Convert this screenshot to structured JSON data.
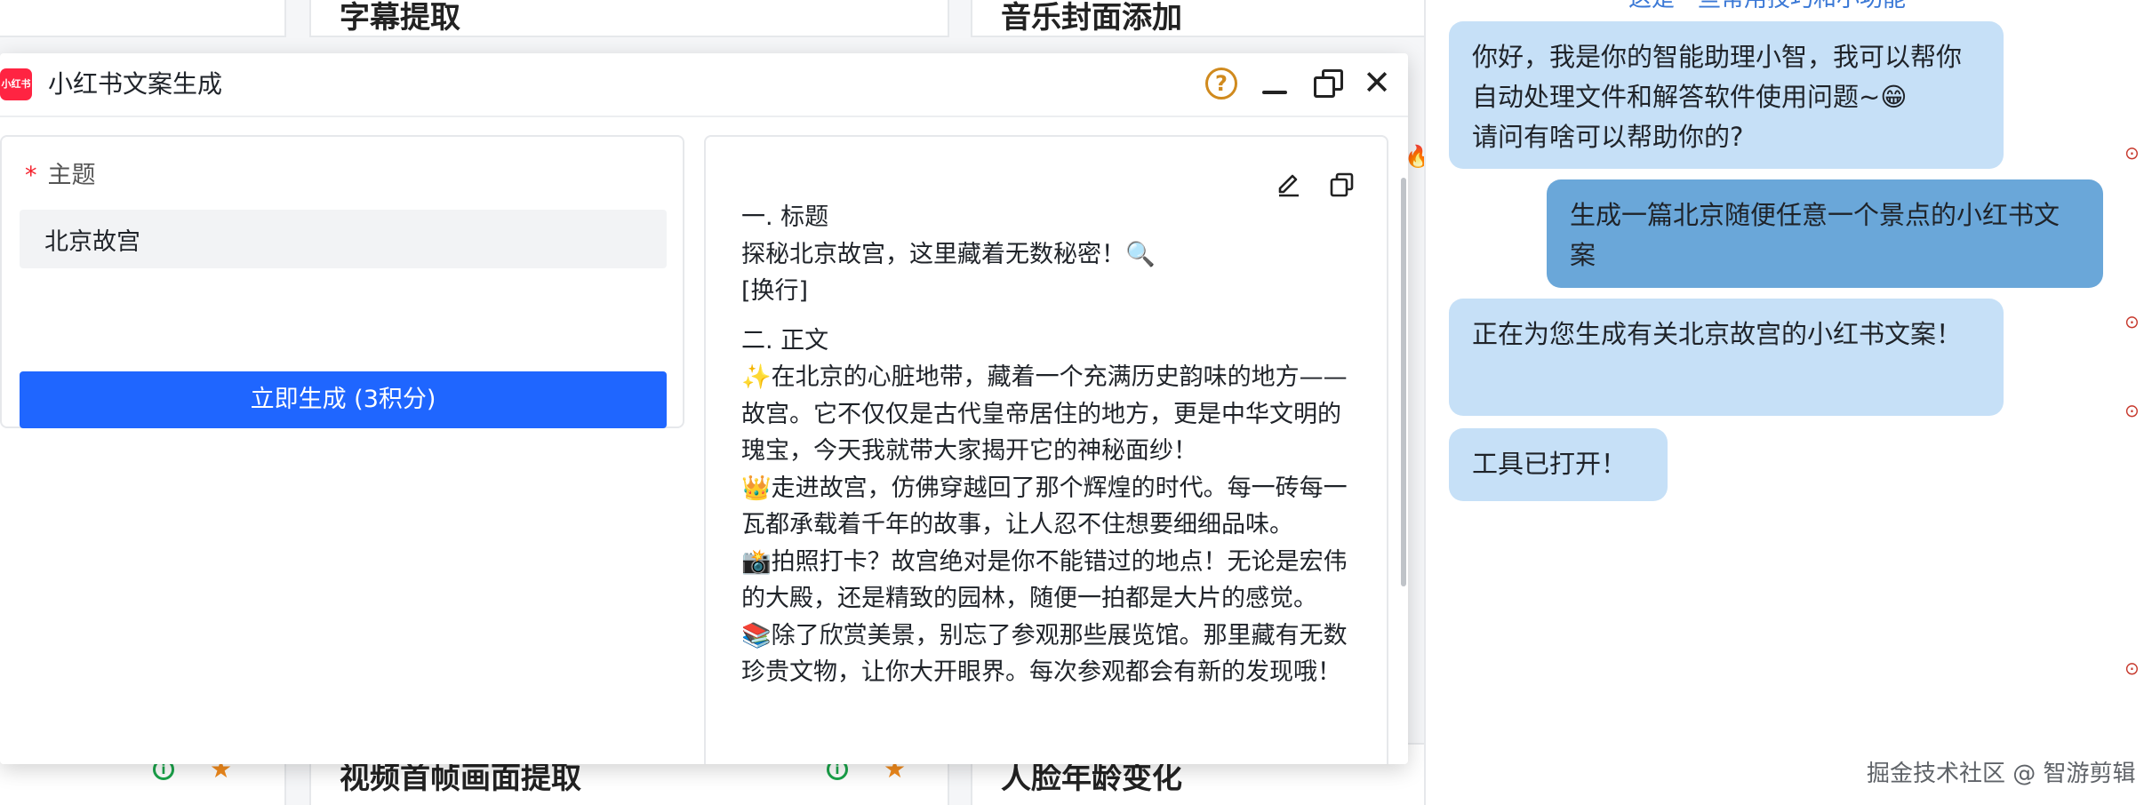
{
  "background": {
    "cards": [
      {
        "title": "字幕提取"
      },
      {
        "title": "音乐封面添加"
      },
      {
        "title": "视频首帧画面提取"
      },
      {
        "title": "人脸年龄变化"
      }
    ]
  },
  "modal": {
    "logo_text": "小红书",
    "title": "小红书文案生成",
    "help_symbol": "?",
    "close_symbol": "✕",
    "form": {
      "required_mark": "*",
      "topic_label": "主题",
      "topic_value": "北京故宫",
      "generate_label": "立即生成 (3积分)"
    },
    "result": {
      "lines": [
        "一. 标题",
        "探秘北京故宫，这里藏着无数秘密！🔍",
        "[换行]",
        "二. 正文",
        "✨在北京的心脏地带，藏着一个充满历史韵味的地方——故宫。它不仅仅是古代皇帝居住的地方，更是中华文明的瑰宝，今天我就带大家揭开它的神秘面纱！",
        "👑走进故宫，仿佛穿越回了那个辉煌的时代。每一砖每一瓦都承载着千年的故事，让人忍不住想要细细品味。",
        "📸拍照打卡？故宫绝对是你不能错过的地点！无论是宏伟的大殿，还是精致的园林，随便一拍都是大片的感觉。",
        "📚除了欣赏美景，别忘了参观那些展览馆。那里藏有无数珍贵文物，让你大开眼界。每次参观都会有新的发现哦！"
      ]
    }
  },
  "chat": {
    "top_link": "这是一些常用技巧和小功能",
    "messages": [
      {
        "role": "bot",
        "text": "你好，我是你的智能助理小智，我可以帮你自动处理文件和解答软件使用问题~😁\n请问有啥可以帮助你的?"
      },
      {
        "role": "user",
        "text": "生成一篇北京随便任意一个景点的小红书文案"
      },
      {
        "role": "bot",
        "text": "正在为您生成有关北京故宫的小红书文案！"
      },
      {
        "role": "bot",
        "text": "工具已打开！"
      }
    ]
  },
  "watermark": "掘金技术社区 @ 智游剪辑",
  "colors": {
    "primary_button": "#1f66ff",
    "bot_bubble": "#c6e0f7",
    "user_bubble": "#6aa7d9",
    "required_star": "#f5222d",
    "brand_red": "#ff2442"
  }
}
